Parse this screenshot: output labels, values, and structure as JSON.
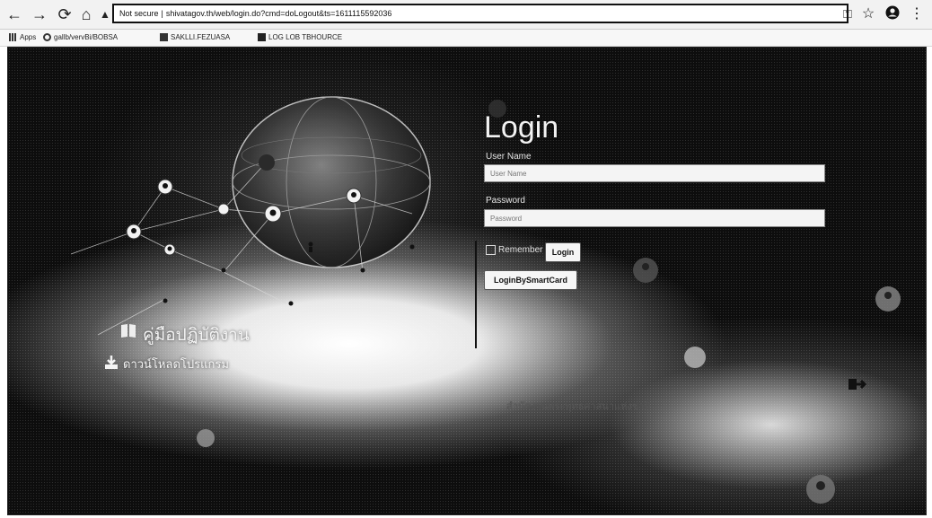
{
  "browser": {
    "back_icon": "back-arrow-icon",
    "forward_icon": "forward-arrow-icon",
    "reload_icon": "reload-icon",
    "home_icon": "home-icon",
    "security_label": "Not secure",
    "url": "shivatagov.th/web/login.do?cmd=doLogout&ts=1611115592036",
    "right_icons": [
      "key-icon",
      "star-icon",
      "profile-icon",
      "menu-kebab-icon"
    ]
  },
  "bookmarks": [
    {
      "label": "Apps",
      "icon": "apps-grid-icon"
    },
    {
      "label": "gallb/vervBi/BOBSA",
      "icon": "google-icon"
    },
    {
      "label": "SAKLLI.FEZUASA",
      "icon": "bookmark-icon"
    },
    {
      "label": "LOG LOB TBHOURCE",
      "icon": "bookmark-icon"
    }
  ],
  "login": {
    "title": "Login",
    "username_label": "User Name",
    "username_placeholder": "User Name",
    "password_label": "Password",
    "password_placeholder": "Password",
    "remember_label": "Remember",
    "login_button": "Login",
    "smartcard_button": "LoginBySmartCard"
  },
  "menu": {
    "item1": "คู่มือปฏิบัติงาน",
    "item2": "ดาวน์โหลดโปรแกรม",
    "footer": "สำนักงานพระพุทธศาสนาแห่งชาติ"
  },
  "colors": {
    "background_dark": "#0e0e0e",
    "panel_text": "#f2f2f2",
    "button_bg": "#f6f6f6"
  }
}
